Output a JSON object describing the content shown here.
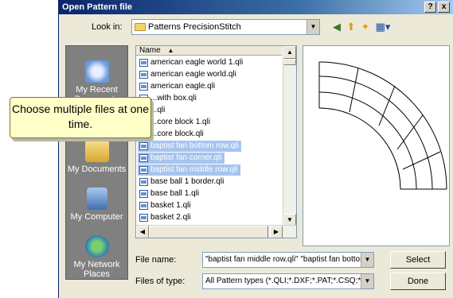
{
  "window": {
    "title": "Open Pattern file",
    "help_label": "?",
    "close_label": "x"
  },
  "toolbar": {
    "look_in_label": "Look in:",
    "look_in_value": "Patterns PrecisionStitch",
    "icons": [
      "back-icon",
      "up-folder-icon",
      "new-folder-icon",
      "views-menu-icon"
    ]
  },
  "places": [
    {
      "label": "My Recent Documents",
      "icon": "recent-documents-icon"
    },
    {
      "label": "My Documents",
      "icon": "my-documents-icon"
    },
    {
      "label": "My Computer",
      "icon": "my-computer-icon"
    },
    {
      "label": "My Network Places",
      "icon": "network-places-icon"
    }
  ],
  "file_list": {
    "column_header": "Name",
    "files": [
      {
        "name": "american eagle world 1.qli",
        "selected": false
      },
      {
        "name": "american eagle world.qli",
        "selected": false
      },
      {
        "name": "american eagle.qli",
        "selected": false
      },
      {
        "name": "...with box.qli",
        "selected": false
      },
      {
        "name": "...qli",
        "selected": false
      },
      {
        "name": "...core block 1.qli",
        "selected": false
      },
      {
        "name": "...core block.qli",
        "selected": false
      },
      {
        "name": "baptist fan bottom row.qli",
        "selected": true
      },
      {
        "name": "baptist fan corner.qli",
        "selected": true
      },
      {
        "name": "baptist fan middle row.qli",
        "selected": true
      },
      {
        "name": "base ball 1 border.qli",
        "selected": false
      },
      {
        "name": "base ball 1.qli",
        "selected": false
      },
      {
        "name": "basket 1.qli",
        "selected": false
      },
      {
        "name": "basket 2.qli",
        "selected": false
      }
    ]
  },
  "file_name": {
    "label": "File name:",
    "value": "\"baptist fan middle row.qli\" \"baptist fan bottom r"
  },
  "file_type": {
    "label": "Files of type:",
    "value": "All Pattern types (*.QLI;*.DXF;*.PAT;*.CSQ;*.CS"
  },
  "buttons": {
    "select": "Select",
    "done": "Done"
  },
  "callout": {
    "text": "Choose multiple files at one time."
  }
}
